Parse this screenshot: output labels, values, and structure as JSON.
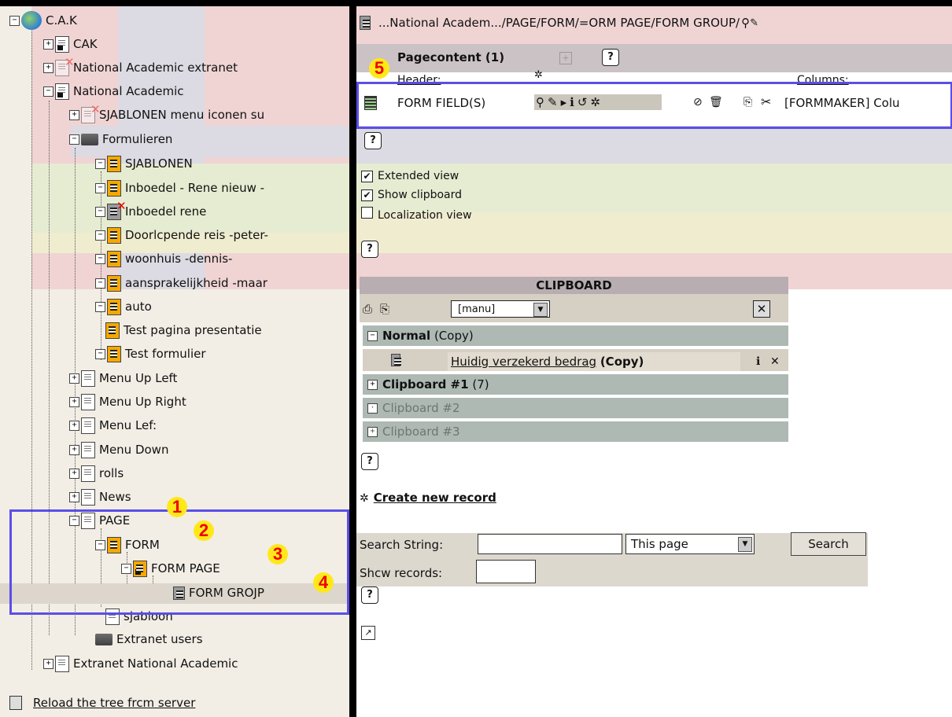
{
  "tree": {
    "root": "C.A.K",
    "nodes": {
      "cak": "CAK",
      "extranet": "National Academic extranet",
      "national_academic": "National Academic",
      "sjablonen_menu": "SJABLONEN menu iconen su",
      "formulieren": "Formulieren",
      "sjablonen": "SJABLONEN",
      "inboedel_rene_nieuw": "Inboedel - Rene nieuw -",
      "inboedel_rene": "Inboedel  rene",
      "doorlopende": "Doorlcpende reis -peter-",
      "woonhuis": "woonhuis -dennis-",
      "aansprakelijkheid": "aansprakelijkheid -maar",
      "auto": "auto",
      "test_pagina": "Test pagina presentatie",
      "test_formulier": "Test formulier",
      "menu_up_left": "Menu Up Left",
      "menu_up_right": "Menu Up Right",
      "menu_left": "Menu Lef:",
      "menu_down": "Menu Down",
      "rolls": "rolls",
      "news": "News",
      "page": "PAGE",
      "form": "FORM",
      "form_page": "FORM PAGE",
      "form_group": "FORM GROJP",
      "sjabloon": "sjabloon",
      "extranet_users": "Extranet users",
      "extranet_national": "Extranet National Academic"
    },
    "reload": "Reload the tree frcm server"
  },
  "badges": {
    "b1": "1",
    "b2": "2",
    "b3": "3",
    "b4": "4",
    "b5": "5"
  },
  "right": {
    "breadcrumb": "...National Academ.../PAGE/FORM/=ORM PAGE/FORM GROUP/",
    "pagecontent": "Pagecontent (1)",
    "header_col": "Header:",
    "columns_col": "Columns:",
    "record_title": "FORM FIELD(S)",
    "record_column": "[FORMMAKER] Colu",
    "extended_view": "Extended view",
    "show_clipboard": "Show clipboard",
    "localization_view": "Localization view",
    "clipboard": {
      "title": "CLIPBOARD",
      "select_value": "[manu]",
      "normal": "Normal",
      "normal_suffix": "(Copy)",
      "item": "Huidig verzekerd bedrag",
      "item_suffix": "(Copy)",
      "cb1": "Clipboard #1",
      "cb1_count": "(7)",
      "cb2": "Clipboard #2",
      "cb3": "Clipboard #3"
    },
    "create_new": "Create new record",
    "search_label": "Search String:",
    "search_scope": "This page",
    "search_button": "Search",
    "show_records": "Shcw records:"
  },
  "colors": {
    "highlight_box": "#5b4ee8",
    "badge_bg": "#ffe81a",
    "badge_fg": "#e00000"
  }
}
